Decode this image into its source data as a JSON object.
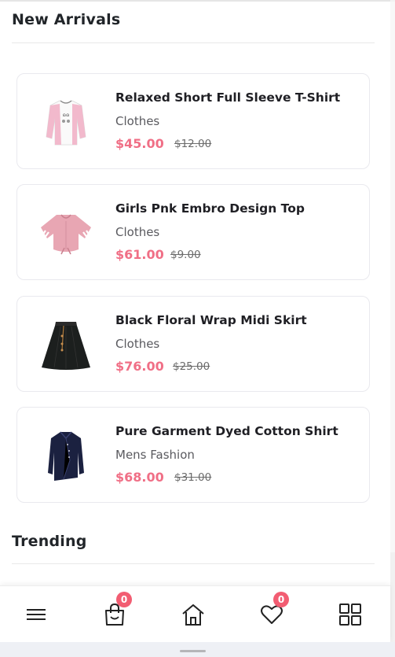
{
  "sections": {
    "new_arrivals_title": "New Arrivals",
    "trending_title": "Trending"
  },
  "products": [
    {
      "name": "Relaxed Short Full Sleeve T-Shirt",
      "category": "Clothes",
      "price": "$45.00",
      "old_price": "$12.00",
      "image_icon": "pink-sweatshirt-image"
    },
    {
      "name": "Girls Pnk Embro Design Top",
      "category": "Clothes",
      "price": "$61.00",
      "old_price": "$9.00",
      "image_icon": "pink-top-image"
    },
    {
      "name": "Black Floral Wrap Midi Skirt",
      "category": "Clothes",
      "price": "$76.00",
      "old_price": "$25.00",
      "image_icon": "black-skirt-image"
    },
    {
      "name": "Pure Garment Dyed Cotton Shirt",
      "category": "Mens Fashion",
      "price": "$68.00",
      "old_price": "$31.00",
      "image_icon": "navy-shirt-image"
    }
  ],
  "bottom_nav": {
    "items": [
      {
        "icon": "menu-icon"
      },
      {
        "icon": "shopping-bag-icon",
        "badge": "0"
      },
      {
        "icon": "home-icon"
      },
      {
        "icon": "heart-icon",
        "badge": "0"
      },
      {
        "icon": "grid-icon"
      }
    ]
  },
  "colors": {
    "price": "#f06f86",
    "badge": "#f25d72",
    "text": "#212529"
  }
}
